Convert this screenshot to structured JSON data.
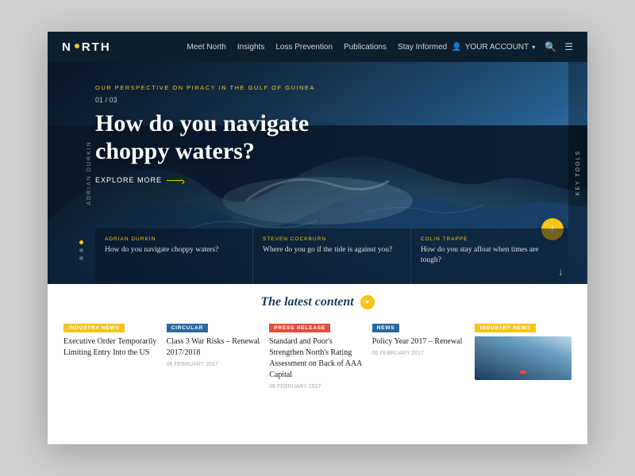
{
  "brand": {
    "logo_letter": "N",
    "logo_name": "ORTH"
  },
  "navbar": {
    "links": [
      "Meet North",
      "Insights",
      "Loss Prevention",
      "Publications",
      "Stay Informed"
    ],
    "account_label": "YOUR ACCOUNT",
    "search_icon": "🔍",
    "menu_icon": "☰"
  },
  "hero": {
    "slide_label": "OUR PERSPECTIVE ON PIRACY IN THE GULF OF GUINEA",
    "slide_counter": "01 / 03",
    "title": "How do you navigate choppy waters?",
    "cta_label": "EXPLORE MORE",
    "author": "ADRIAN DURKIN",
    "key_tools_label": "KEY TOOLS",
    "slides": [
      {
        "author": "ADRIAN DURKIN",
        "text": "How do you navigate choppy waters?"
      },
      {
        "author": "STEVEN COCKBURN",
        "text": "Where do you go if the tide is against you?"
      },
      {
        "author": "COLIN TRAPPE",
        "text": "How do you stay afloat when times are tough?"
      }
    ]
  },
  "latest": {
    "prefix": "The latest",
    "highlight": "content",
    "news": [
      {
        "tag": "INDUSTRY NEWS",
        "tag_class": "tag-industry",
        "title": "Executive Order Temporarily Limiting Entry Into the US",
        "date": "",
        "has_image": false
      },
      {
        "tag": "CIRCULAR",
        "tag_class": "tag-circular",
        "title": "Class 3 War Risks – Renewal 2017/2018",
        "date": "06 FEBRUARY 2017",
        "has_image": false
      },
      {
        "tag": "PRESS RELEASE",
        "tag_class": "tag-press",
        "title": "Standard and Poor's Strengthen North's Rating Assessment on Back of AAA Capital",
        "date": "06 FEBRUARY 2017",
        "has_image": false
      },
      {
        "tag": "NEWS",
        "tag_class": "tag-news",
        "title": "Policy Year 2017 – Renewal",
        "date": "06 FEBRUARY 2017",
        "has_image": false
      },
      {
        "tag": "INDUSTRY NEWS",
        "tag_class": "tag-industry",
        "title": "",
        "date": "",
        "has_image": true
      }
    ]
  }
}
